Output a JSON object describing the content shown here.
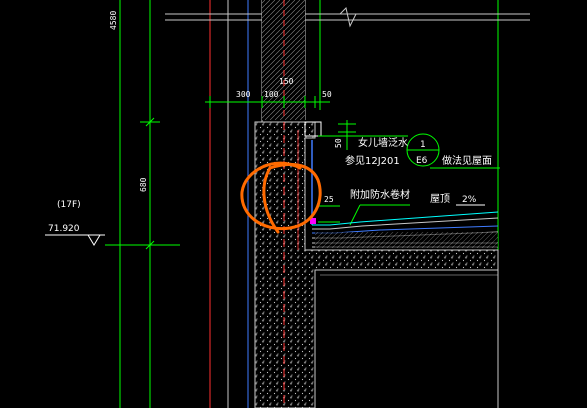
{
  "drawing": {
    "dims": {
      "top_height": "4580",
      "width_300": "300",
      "width_100": "100",
      "width_150": "150",
      "width_50_right": "50",
      "height_50": "50",
      "height_680": "680",
      "height_25": "25",
      "slope": "2%"
    },
    "labels": {
      "parapet_flashing": "女儿墙泛水",
      "reference": "参见12J201",
      "detail_no": "1",
      "sheet_no": "E6",
      "roof_practice": "做法见屋面",
      "additional_waterproof": "附加防水卷材",
      "roof": "屋顶",
      "floor_tag": "(17F)",
      "elevation": "71.920"
    },
    "colors": {
      "background": "#000000",
      "dim_line": "#00ff00",
      "concrete": "#c8c8c8",
      "red_line": "#ff3030",
      "cyan": "#00ffff",
      "annotation": "#ff6a00",
      "white": "#ffffff",
      "blue": "#3f7bff"
    }
  }
}
